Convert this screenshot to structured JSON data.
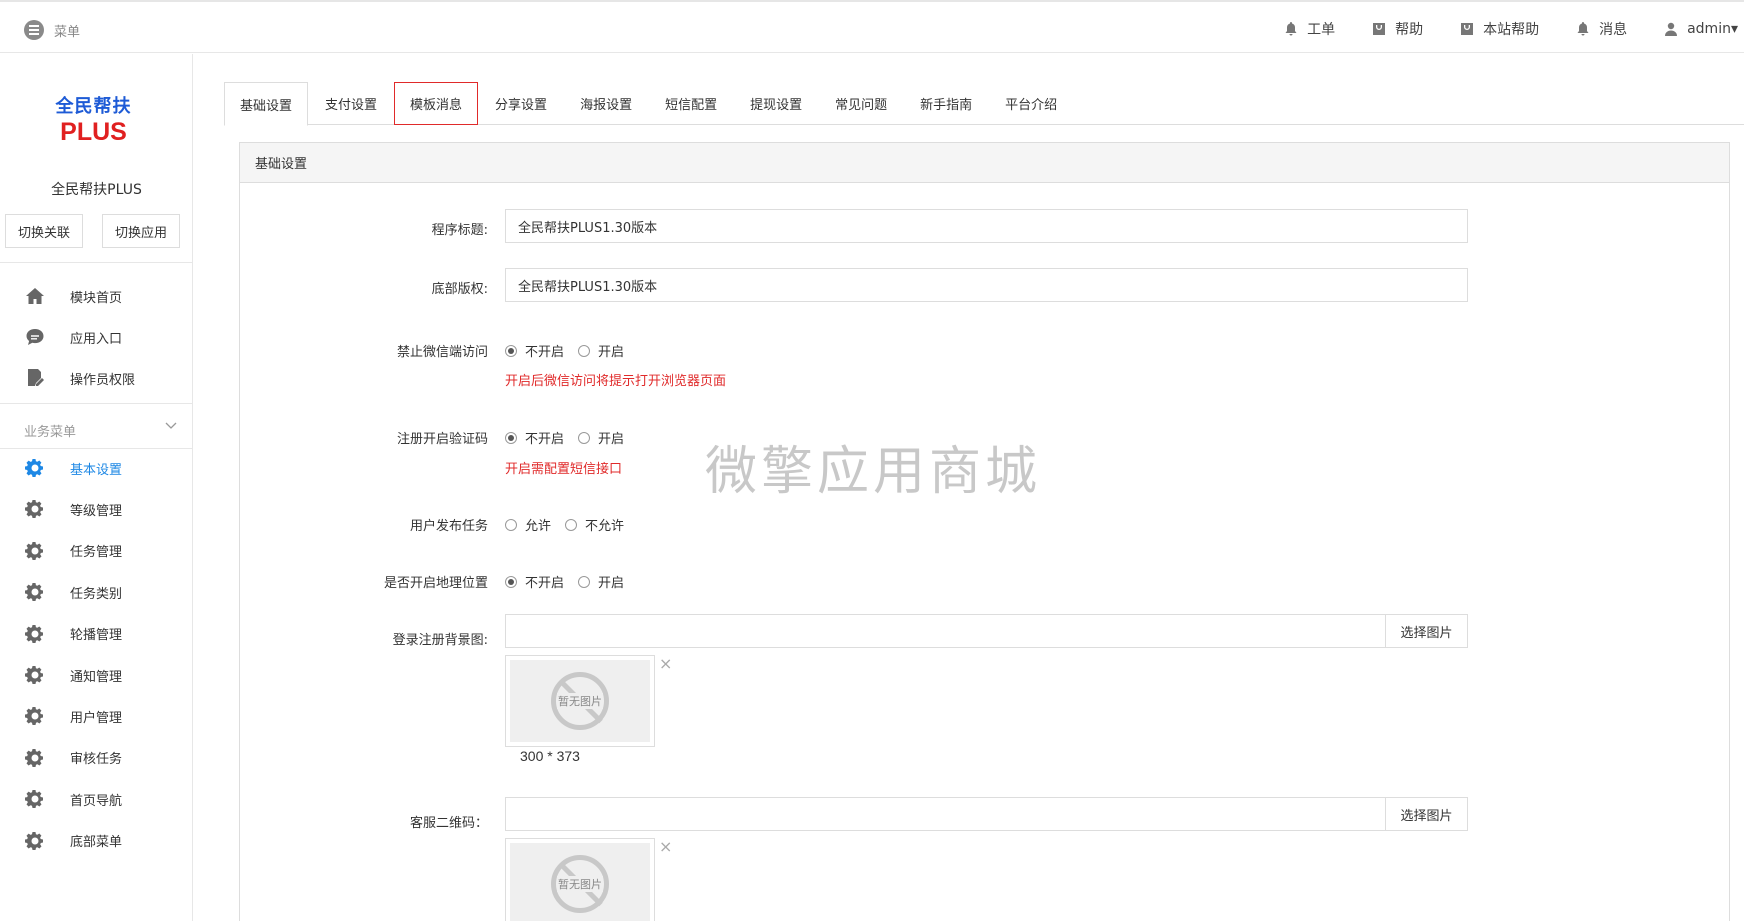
{
  "topbar": {
    "menu_label": "菜单",
    "items": [
      {
        "label": "工单",
        "icon": "bell-icon"
      },
      {
        "label": "帮助",
        "icon": "bag-icon"
      },
      {
        "label": "本站帮助",
        "icon": "bag-icon"
      },
      {
        "label": "消息",
        "icon": "bell-icon"
      },
      {
        "label": "admin▾",
        "icon": "user-icon"
      }
    ]
  },
  "sidebar": {
    "logo_line1": "全民帮扶",
    "logo_line2": "PLUS",
    "app_name": "全民帮扶PLUS",
    "switch_relation": "切换关联",
    "switch_app": "切换应用",
    "top_items": [
      {
        "label": "模块首页",
        "icon": "home-icon"
      },
      {
        "label": "应用入口",
        "icon": "chat-icon"
      },
      {
        "label": "操作员权限",
        "icon": "edit-doc-icon"
      }
    ],
    "group_label": "业务菜单",
    "group_items": [
      {
        "label": "基本设置",
        "icon": "gear-icon",
        "active": true
      },
      {
        "label": "等级管理",
        "icon": "gear-icon"
      },
      {
        "label": "任务管理",
        "icon": "gear-icon"
      },
      {
        "label": "任务类别",
        "icon": "gear-icon"
      },
      {
        "label": "轮播管理",
        "icon": "gear-icon"
      },
      {
        "label": "通知管理",
        "icon": "gear-icon"
      },
      {
        "label": "用户管理",
        "icon": "gear-icon"
      },
      {
        "label": "审核任务",
        "icon": "gear-icon"
      },
      {
        "label": "首页导航",
        "icon": "gear-icon"
      },
      {
        "label": "底部菜单",
        "icon": "gear-icon"
      }
    ]
  },
  "tabs": [
    "基础设置",
    "支付设置",
    "模板消息",
    "分享设置",
    "海报设置",
    "短信配置",
    "提现设置",
    "常见问题",
    "新手指南",
    "平台介绍"
  ],
  "active_tab": 0,
  "highlight_tab": 2,
  "panel": {
    "title": "基础设置",
    "program_title_label": "程序标题:",
    "program_title_value": "全民帮扶PLUS1.30版本",
    "copyright_label": "底部版权:",
    "copyright_value": "全民帮扶PLUS1.30版本",
    "wechat_block_label": "禁止微信端访问",
    "wechat_block_options": [
      "不开启",
      "开启"
    ],
    "wechat_block_hint": "开启后微信访问将提示打开浏览器页面",
    "reg_code_label": "注册开启验证码",
    "reg_code_options": [
      "不开启",
      "开启"
    ],
    "reg_code_hint": "开启需配置短信接口",
    "user_publish_label": "用户发布任务",
    "user_publish_options": [
      "允许",
      "不允许"
    ],
    "geo_label": "是否开启地理位置",
    "geo_options": [
      "不开启",
      "开启"
    ],
    "login_bg_label": "登录注册背景图:",
    "select_image": "选择图片",
    "no_image": "暂无图片",
    "login_bg_size": "300 * 373",
    "qrcode_label": "客服二维码："
  },
  "watermark": "微擎应用商城",
  "colors": {
    "accent": "#1e88e5",
    "danger": "#e02a2a"
  }
}
